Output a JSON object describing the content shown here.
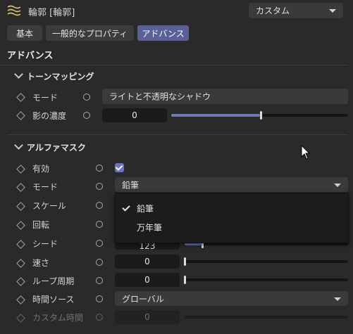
{
  "header": {
    "title": "輪郭 [輪郭]",
    "preset_value": "カスタム"
  },
  "tabs": [
    {
      "label": "基本",
      "active": false
    },
    {
      "label": "一般的なプロパティ",
      "active": false
    },
    {
      "label": "アドバンス",
      "active": true
    }
  ],
  "section_title": "アドバンス",
  "tone_mapping": {
    "label": "トーンマッピング",
    "mode_label": "モード",
    "mode_value": "ライトと不透明なシャドウ",
    "shadow_label": "影の濃度",
    "shadow_value": "0",
    "shadow_fraction": 0.5
  },
  "alpha_mask": {
    "label": "アルファマスク",
    "enabled_label": "有効",
    "enabled": true,
    "mode_label": "モード",
    "mode_value": "鉛筆",
    "scale_label": "スケール",
    "rotation_label": "回転",
    "seed_label": "シード",
    "seed_value": "123",
    "speed_label": "速さ",
    "speed_value": "0",
    "loop_label": "ループ周期",
    "loop_value": "0",
    "time_source_label": "時間ソース",
    "time_source_value": "グローバル",
    "custom_time_label": "カスタム時間",
    "custom_time_value": "0"
  },
  "mode_menu": {
    "items": [
      {
        "label": "鉛筆",
        "checked": true
      },
      {
        "label": "万年筆",
        "checked": false
      }
    ]
  },
  "colors": {
    "accent": "#5b6099",
    "background": "#2a2a2a"
  }
}
